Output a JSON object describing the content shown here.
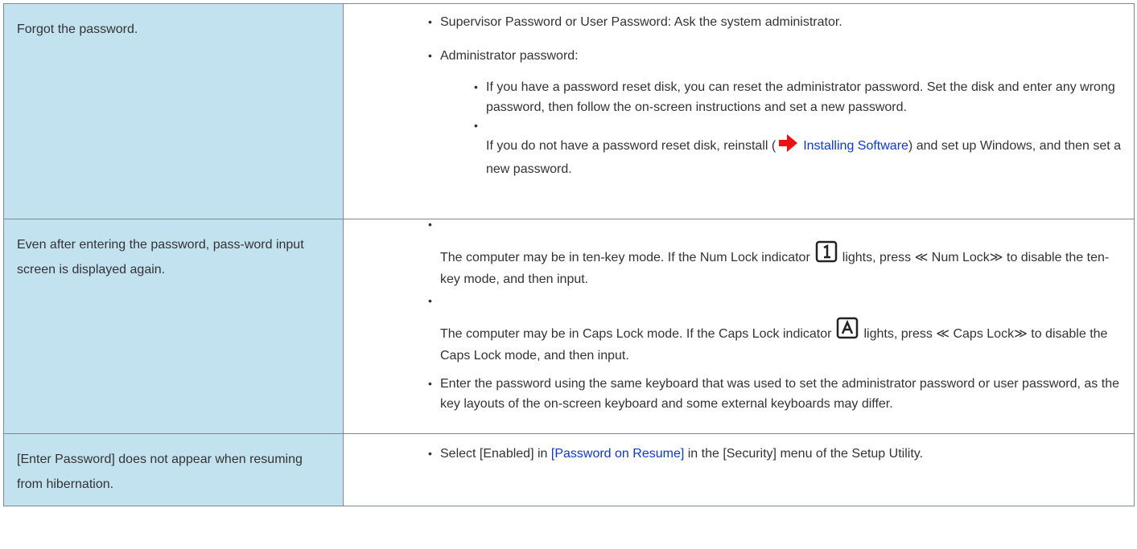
{
  "rows": [
    {
      "problem": "Forgot the password.",
      "bullet1": "Supervisor Password or User Password: Ask the system administrator.",
      "bullet2": "Administrator password:",
      "sub1": "If you have a password reset disk, you can reset the administrator password. Set the disk and enter any wrong password, then follow the on-screen instructions and set a new password.",
      "sub2_pre": "If you do not have a password reset disk, reinstall (",
      "sub2_link": "Installing Software",
      "sub2_post": ") and set up Windows, and then set a new password."
    },
    {
      "problem": "Even after entering the password, pass-word input screen is displayed again.",
      "bullet1_pre": "The computer may be in ten-key mode. If the Num Lock indicator",
      "bullet1_post": "lights, press ≪ Num Lock≫  to disable the ten-key mode, and then input.",
      "bullet2_pre": "The computer may be in Caps Lock mode. If the Caps Lock indicator",
      "bullet2_post": "lights, press ≪ Caps Lock≫  to disable the Caps Lock mode, and then input.",
      "bullet3": "Enter the password using the same keyboard that was used to set the administrator password or user password, as the key layouts of the on-screen keyboard and some external keyboards may differ."
    },
    {
      "problem": "[Enter Password] does not appear when resuming from hibernation.",
      "bullet1_pre": "Select [Enabled] in ",
      "bullet1_link": "[Password on Resume]",
      "bullet1_post": " in the [Security] menu of the Setup Utility."
    }
  ],
  "icons": {
    "arrow": "red-arrow-icon",
    "numlock": "num-lock-indicator-icon",
    "capslock": "caps-lock-indicator-icon"
  },
  "colors": {
    "problem_bg": "#c2e2ef",
    "link": "#0b36e7",
    "arrow": "#ee1111"
  }
}
